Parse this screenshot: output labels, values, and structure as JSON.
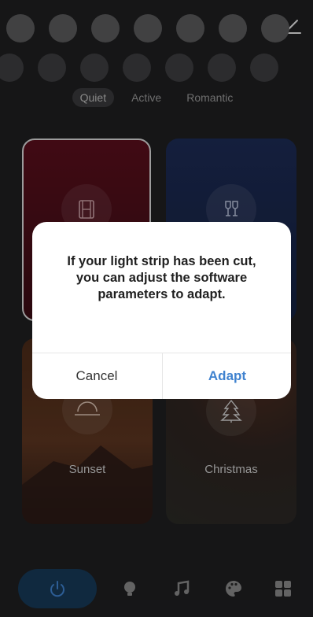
{
  "header": {
    "back_icon": "chevron-left-icon",
    "edit_icon": "pencil-icon"
  },
  "tabs": [
    {
      "label": "Quiet",
      "active": true
    },
    {
      "label": "Active",
      "active": false
    },
    {
      "label": "Romantic",
      "active": false
    }
  ],
  "scenes": [
    {
      "label": "",
      "icon": "film-icon"
    },
    {
      "label": "",
      "icon": "wine-glasses-icon"
    },
    {
      "label": "Sunset",
      "icon": "sunset-icon"
    },
    {
      "label": "Christmas",
      "icon": "christmas-tree-icon"
    }
  ],
  "dialog": {
    "message": "If your light strip has been cut, you can adjust the software parameters to adapt.",
    "cancel_label": "Cancel",
    "confirm_label": "Adapt"
  },
  "nav": {
    "items": [
      "power-icon",
      "bulb-icon",
      "music-icon",
      "palette-icon",
      "grid-icon"
    ]
  },
  "colors": {
    "accent": "#3f82cf",
    "power_bg": "#173a58"
  }
}
